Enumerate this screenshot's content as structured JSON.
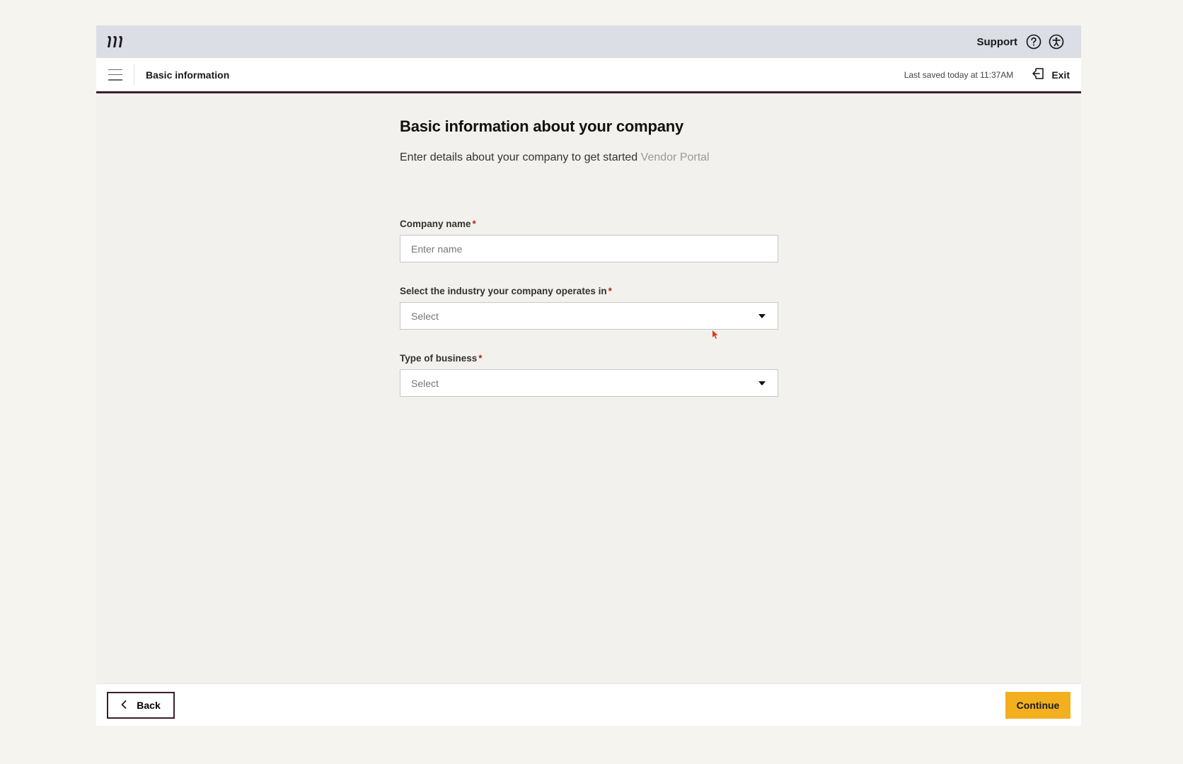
{
  "topbar": {
    "logo_icon": "brand-logo-icon",
    "support_label": "Support",
    "help_icon": "question-circle-icon",
    "accessibility_icon": "accessibility-icon"
  },
  "subheader": {
    "menu_icon": "hamburger-menu-icon",
    "section_title": "Basic information",
    "last_saved": "Last saved today at 11:37AM",
    "exit_label": "Exit",
    "exit_icon": "exit-icon"
  },
  "main": {
    "heading": "Basic information about your company",
    "subheading": "Enter details about your company to get started",
    "subheading_ghost": "Vendor Portal",
    "fields": [
      {
        "label": "Company name",
        "required": "*",
        "placeholder": "Enter name"
      },
      {
        "label": "Select the industry your company operates in",
        "required": "*",
        "value": "Select"
      },
      {
        "label": "Type of business",
        "required": "*",
        "value": "Select"
      }
    ]
  },
  "footer": {
    "back_label": "Back",
    "continue_label": "Continue"
  },
  "colors": {
    "accent": "#f2b01e",
    "brand_dark": "#3a1f2c",
    "required": "#b3261e"
  }
}
